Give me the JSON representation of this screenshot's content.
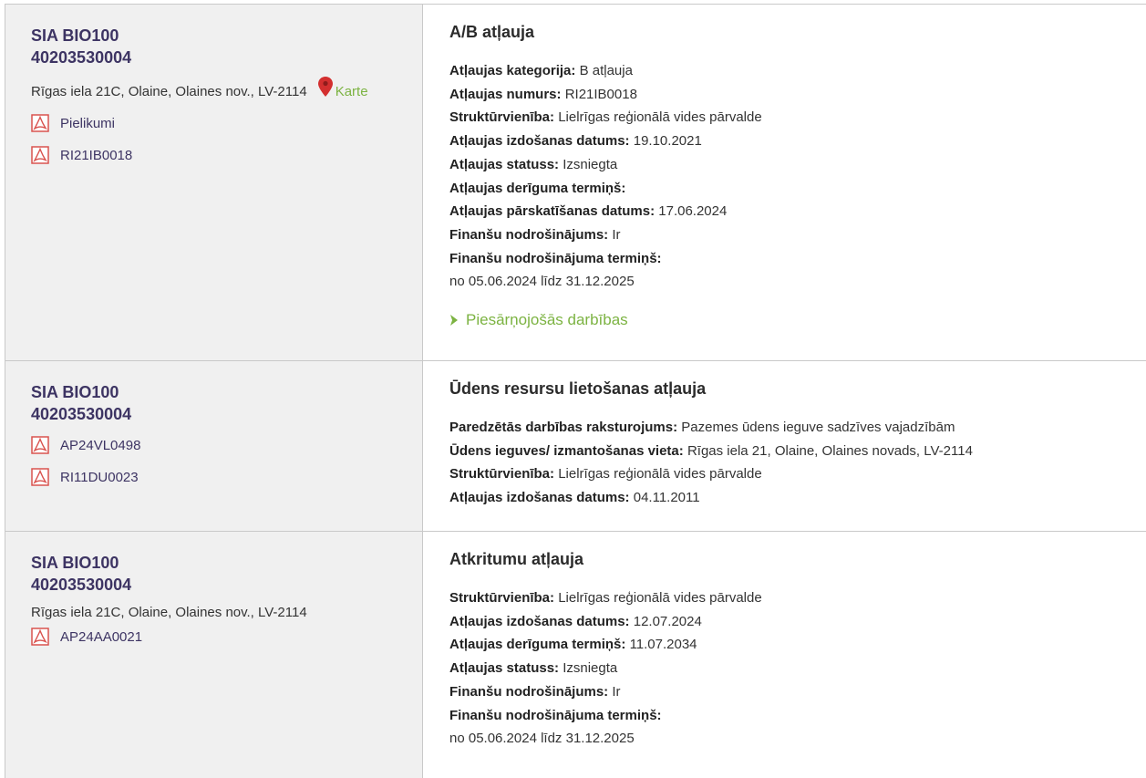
{
  "rows": [
    {
      "company_name": "SIA BIO100",
      "company_code": "40203530004",
      "address": "Rīgas iela 21C, Olaine, Olaines nov., LV-2114",
      "map_link": "Karte",
      "documents": [
        "Pielikumi",
        "RI21IB0018"
      ],
      "permit_title": "A/B atļauja",
      "fields": [
        {
          "label": "Atļaujas kategorija:",
          "value": "B atļauja"
        },
        {
          "label": "Atļaujas numurs:",
          "value": "RI21IB0018"
        },
        {
          "label": "Struktūrvienība:",
          "value": "Lielrīgas reģionālā vides pārvalde"
        },
        {
          "label": "Atļaujas izdošanas datums:",
          "value": "19.10.2021"
        },
        {
          "label": "Atļaujas statuss:",
          "value": "Izsniegta"
        },
        {
          "label": "Atļaujas derīguma termiņš:",
          "value": ""
        },
        {
          "label": "Atļaujas pārskatīšanas datums:",
          "value": "17.06.2024"
        },
        {
          "label": "Finanšu nodrošinājums:",
          "value": "Ir"
        },
        {
          "label": "Finanšu nodrošinājuma termiņš:",
          "value": ""
        }
      ],
      "period": "no 05.06.2024 līdz 31.12.2025",
      "expander": "Piesārņojošās darbības"
    },
    {
      "company_name": "SIA BIO100",
      "company_code": "40203530004",
      "documents": [
        "AP24VL0498",
        "RI11DU0023"
      ],
      "permit_title": "Ūdens resursu lietošanas atļauja",
      "fields": [
        {
          "label": "Paredzētās darbības raksturojums:",
          "value": "Pazemes ūdens ieguve sadzīves vajadzībām"
        },
        {
          "label": "Ūdens ieguves/ izmantošanas vieta:",
          "value": "Rīgas iela 21, Olaine, Olaines novads, LV-2114"
        },
        {
          "label": "Struktūrvienība:",
          "value": "Lielrīgas reģionālā vides pārvalde"
        },
        {
          "label": "Atļaujas izdošanas datums:",
          "value": "04.11.2011"
        }
      ]
    },
    {
      "company_name": "SIA BIO100",
      "company_code": "40203530004",
      "address": "Rīgas iela 21C, Olaine, Olaines nov., LV-2114",
      "documents": [
        "AP24AA0021"
      ],
      "permit_title": "Atkritumu atļauja",
      "fields": [
        {
          "label": "Struktūrvienība:",
          "value": "Lielrīgas reģionālā vides pārvalde"
        },
        {
          "label": "Atļaujas izdošanas datums:",
          "value": "12.07.2024"
        },
        {
          "label": "Atļaujas derīguma termiņš:",
          "value": "11.07.2034"
        },
        {
          "label": "Atļaujas statuss:",
          "value": "Izsniegta"
        },
        {
          "label": "Finanšu nodrošinājums:",
          "value": "Ir"
        },
        {
          "label": "Finanšu nodrošinājuma termiņš:",
          "value": ""
        }
      ],
      "period": "no 05.06.2024 līdz 31.12.2025"
    }
  ],
  "colors": {
    "company": "#3d3463",
    "link_green": "#7cb342",
    "pdf_red": "#d9534f",
    "pin_red": "#d32f2f",
    "left_bg": "#f0f0f0",
    "border": "#c9c9c9"
  },
  "icons": {
    "document": "pdf-icon",
    "map": "map-pin-icon",
    "expander": "chevron-right-icon"
  }
}
